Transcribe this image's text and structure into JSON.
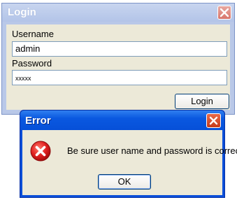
{
  "login_window": {
    "title": "Login",
    "close_icon": "close-icon",
    "username_label": "Username",
    "username_value": "admin",
    "password_label": "Password",
    "password_value": "xxxxx",
    "login_button_label": "Login",
    "titlebar_color": "#b9c8e8"
  },
  "error_dialog": {
    "title": "Error",
    "close_icon": "close-icon",
    "icon": "error-icon",
    "message": "Be sure user name and password is correct",
    "ok_button_label": "OK",
    "titlebar_color": "#0a58e0",
    "icon_color": "#d9232a"
  }
}
